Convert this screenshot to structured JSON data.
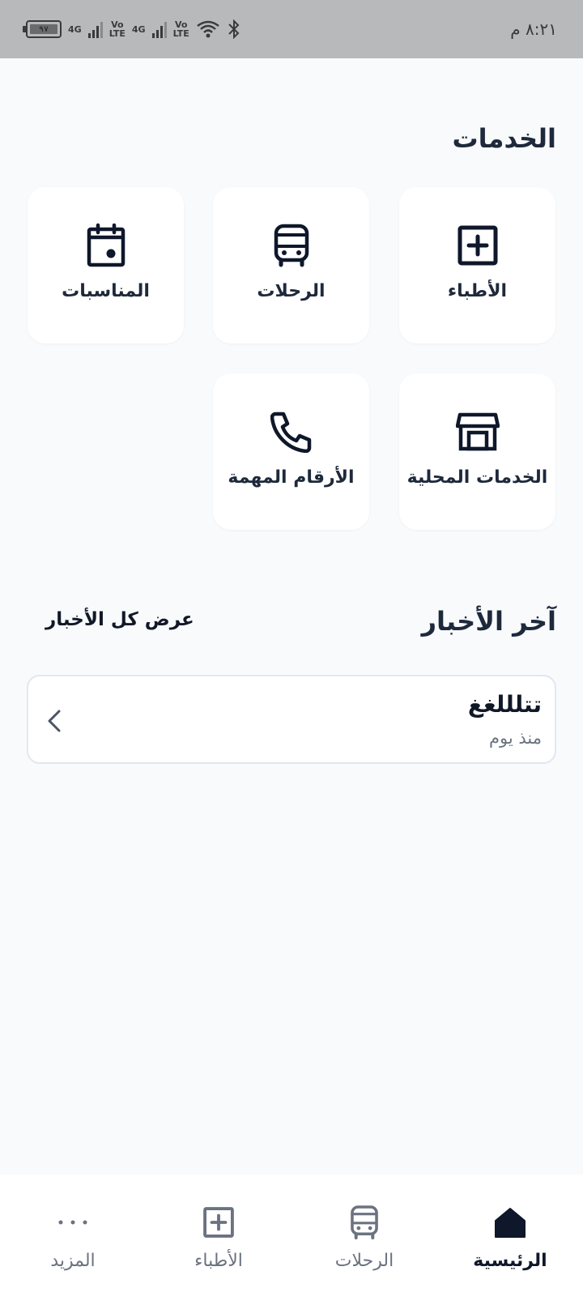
{
  "status_bar": {
    "time": "٨:٢١ م",
    "battery": "٩٧",
    "net1_top": "4G",
    "net2_top": "Vo",
    "net2_bottom": "LTE",
    "net3_top": "4G",
    "net4_top": "Vo",
    "net4_bottom": "LTE"
  },
  "services": {
    "title": "الخدمات",
    "items": [
      {
        "label": "الأطباء",
        "icon": "medical-plus-icon"
      },
      {
        "label": "الرحلات",
        "icon": "bus-icon"
      },
      {
        "label": "المناسبات",
        "icon": "calendar-event-icon"
      },
      {
        "label": "الخدمات المحلية",
        "icon": "store-icon"
      },
      {
        "label": "الأرقام المهمة",
        "icon": "phone-icon"
      }
    ]
  },
  "news": {
    "title": "آخر الأخبار",
    "view_all": "عرض كل الأخبار",
    "items": [
      {
        "title": "تتلللغغ",
        "time": "منذ يوم"
      }
    ]
  },
  "nav": {
    "items": [
      {
        "label": "الرئيسية",
        "icon": "home-icon",
        "active": true
      },
      {
        "label": "الرحلات",
        "icon": "bus-icon"
      },
      {
        "label": "الأطباء",
        "icon": "medical-plus-icon"
      },
      {
        "label": "المزيد",
        "icon": "more-dots-icon"
      }
    ]
  },
  "colors": {
    "background": "#f8fafc",
    "card": "#ffffff",
    "text": "#1e293b",
    "muted": "#6b7280",
    "status_bar": "#b8b9bb"
  }
}
